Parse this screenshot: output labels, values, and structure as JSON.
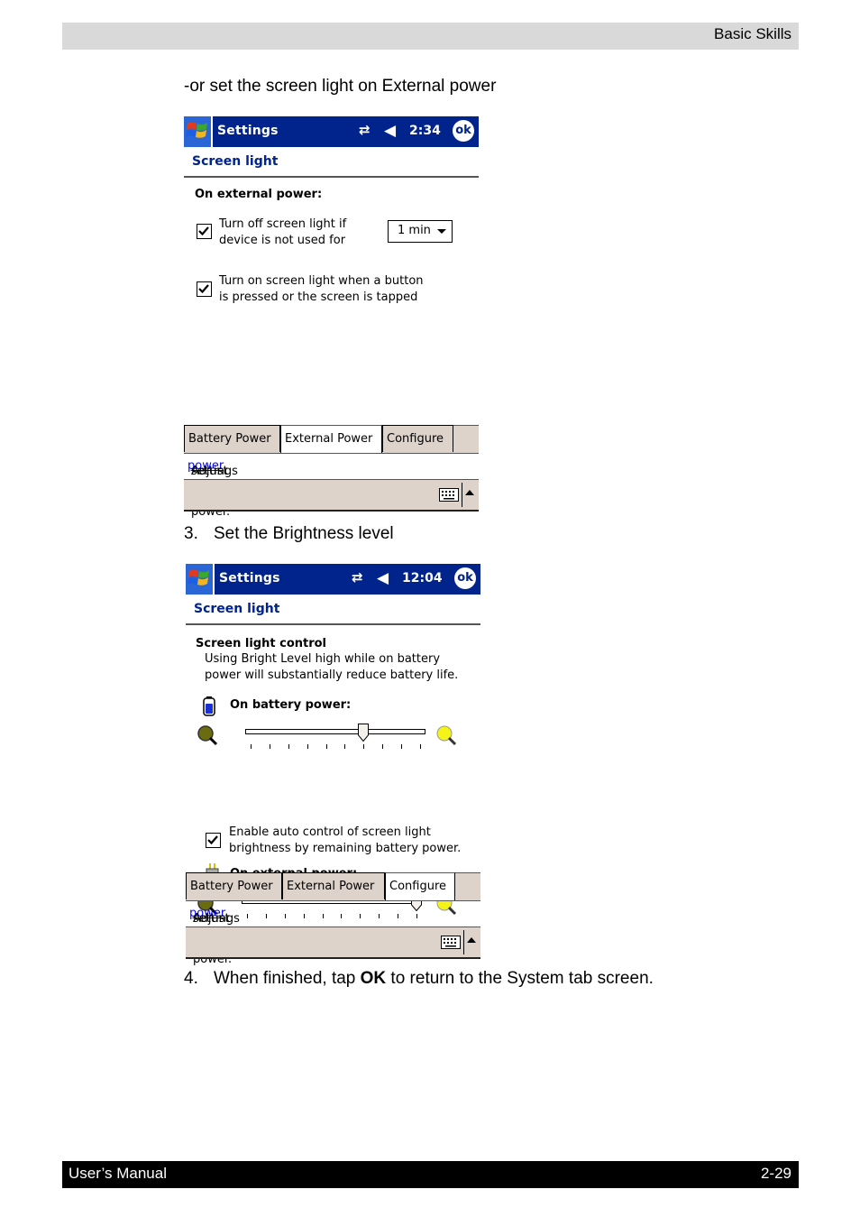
{
  "page": {
    "header_section": "Basic Skills",
    "intro_text": "-or set the screen light on External power",
    "step3": {
      "number": "3.",
      "text": "Set the Brightness level"
    },
    "step4": {
      "number": "4.",
      "text_before": "When finished, tap ",
      "bold": "OK",
      "text_after": " to return to the System tab screen."
    },
    "footer_left": "User’s Manual",
    "footer_right": "2-29"
  },
  "screen1": {
    "app_title": "Settings",
    "time": "2:34",
    "ok_label": "ok",
    "caption": "Screen light",
    "section_heading": "On external power:",
    "option1": {
      "checked": true,
      "line1": "Turn off screen light if",
      "line2": "device is not used for"
    },
    "timeout_dropdown": {
      "value": "1 min"
    },
    "option2": {
      "checked": true,
      "line1": "Turn on screen light when a button",
      "line2": "is pressed or the screen is tapped"
    },
    "tabs": [
      {
        "label": "Battery Power",
        "active": false
      },
      {
        "label": "External Power",
        "active": true
      },
      {
        "label": "Configure",
        "active": false
      }
    ],
    "status": {
      "before": "Adjust ",
      "link": "power",
      "after": " settings to conserve power."
    }
  },
  "screen2": {
    "app_title": "Settings",
    "time": "12:04",
    "ok_label": "ok",
    "caption": "Screen light",
    "control_heading": "Screen light control",
    "warning_line1": "Using Bright Level high while on battery",
    "warning_line2": "power will substantially reduce battery life.",
    "battery_heading": "On battery power:",
    "battery_slider": {
      "value": 6,
      "min": 0,
      "max": 9,
      "ticks": 10
    },
    "auto_control": {
      "checked": true,
      "line1": "Enable auto control of screen light",
      "line2": "brightness by remaining battery power."
    },
    "external_heading": "On external power:",
    "external_slider": {
      "value": 9,
      "min": 0,
      "max": 9,
      "ticks": 10
    },
    "tabs": [
      {
        "label": "Battery Power",
        "active": false
      },
      {
        "label": "External Power",
        "active": false
      },
      {
        "label": "Configure",
        "active": true
      }
    ],
    "status": {
      "before": "Adjust ",
      "link": "power",
      "after": " settings to conserve power."
    }
  }
}
